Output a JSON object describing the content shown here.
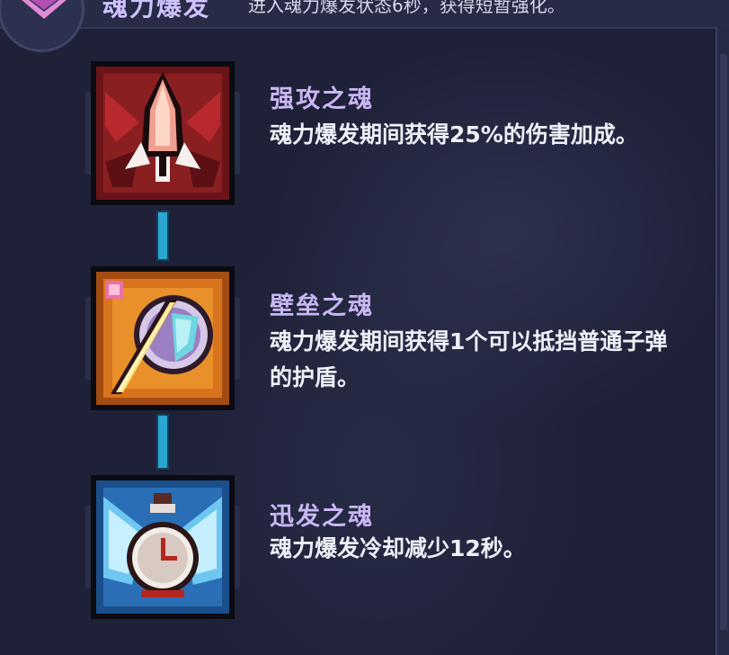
{
  "header": {
    "title": "魂力爆发",
    "description": "进入魂力爆发状态6秒，获得短暂强化。"
  },
  "skills": [
    {
      "name": "强攻之魂",
      "description": "魂力爆发期间获得25%的伤害加成。",
      "icon": "rocket-icon",
      "frame_color": "#8a1f22"
    },
    {
      "name": "壁垒之魂",
      "description": "魂力爆发期间获得1个可以抵挡普通子弹的护盾。",
      "icon": "shield-sword-icon",
      "frame_color": "#c5651b"
    },
    {
      "name": "迅发之魂",
      "description": "魂力爆发冷却减少12秒。",
      "icon": "winged-clock-icon",
      "frame_color": "#2a6fb5"
    }
  ],
  "colors": {
    "background": "#1e2137",
    "connector": "#2ba6d2",
    "skill_name": "#c9b6f4",
    "skill_text": "#eef0f8"
  }
}
